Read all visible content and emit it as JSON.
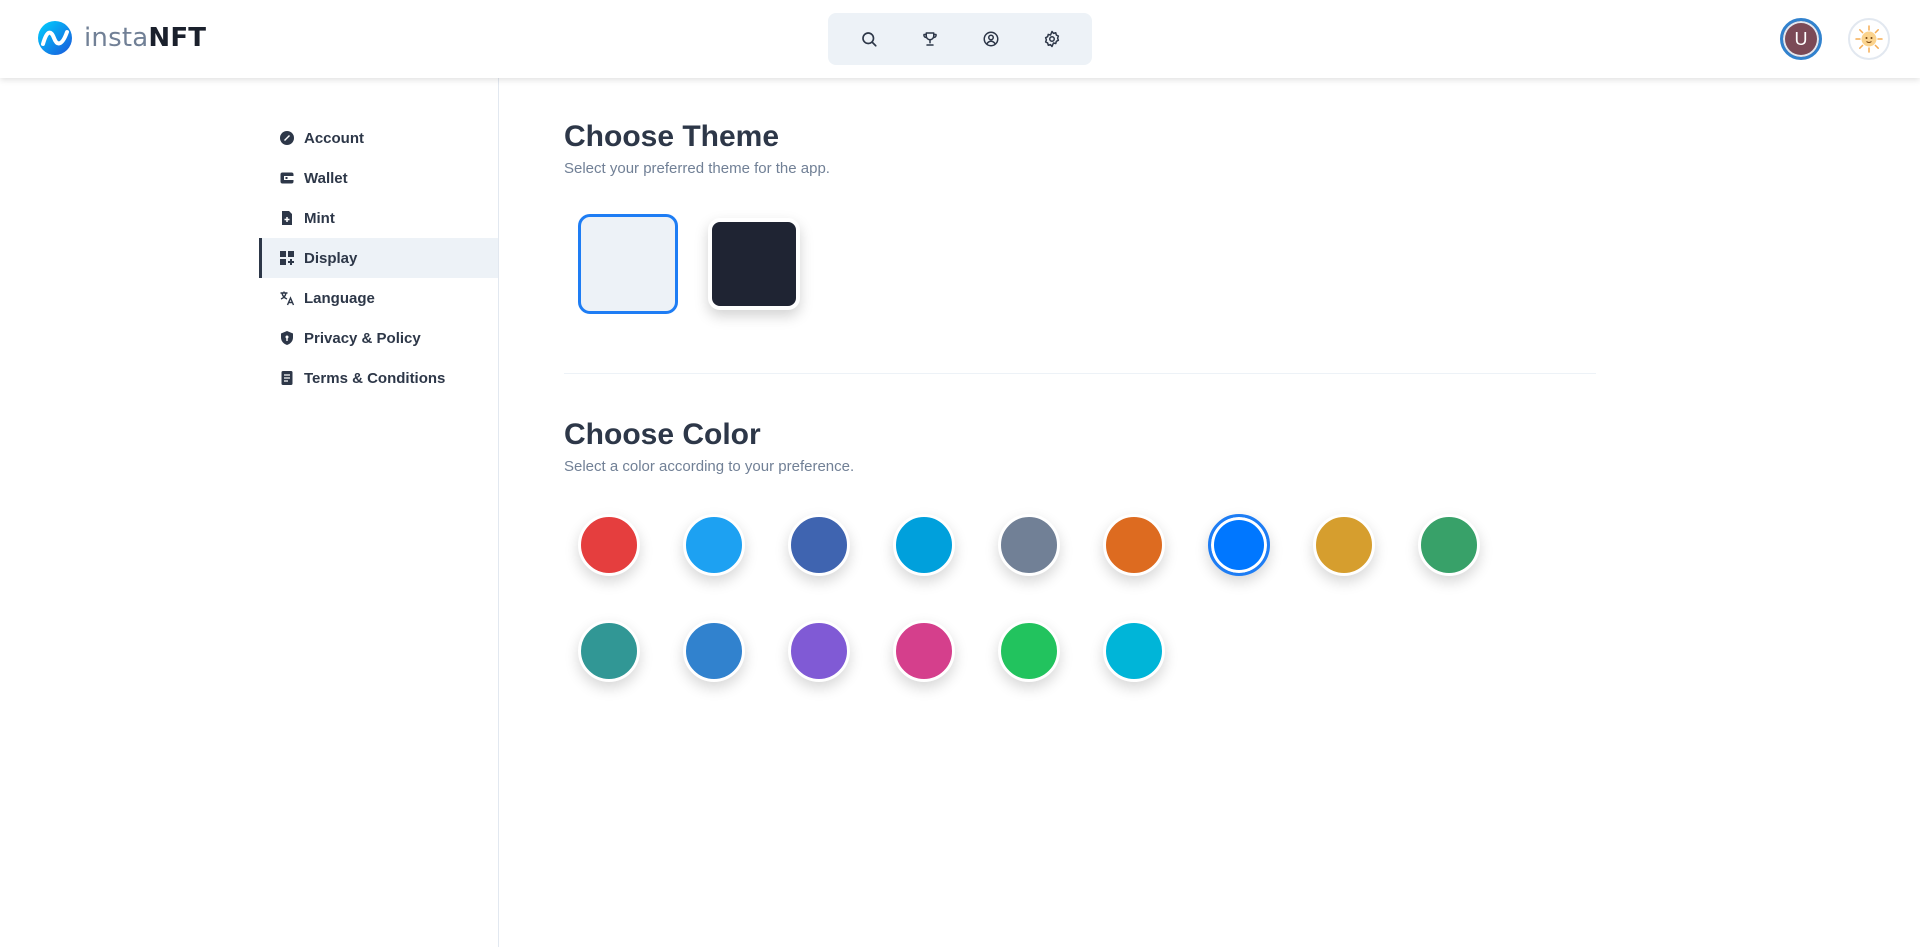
{
  "brand": {
    "name_part1": "insta",
    "name_part2": "NFT"
  },
  "topnav": {
    "icons": [
      "search-icon",
      "trophy-icon",
      "user-circle-icon",
      "gear-icon"
    ]
  },
  "user": {
    "avatar_initial": "U",
    "avatar_color": "#7b4a57"
  },
  "sidebar": {
    "items": [
      {
        "label": "Account",
        "icon": "account-icon"
      },
      {
        "label": "Wallet",
        "icon": "wallet-icon"
      },
      {
        "label": "Mint",
        "icon": "document-plus-icon"
      },
      {
        "label": "Display",
        "icon": "grid-icon",
        "active": true
      },
      {
        "label": "Language",
        "icon": "translate-icon"
      },
      {
        "label": "Privacy & Policy",
        "icon": "shield-icon"
      },
      {
        "label": "Terms & Conditions",
        "icon": "document-icon"
      }
    ]
  },
  "theme": {
    "title": "Choose Theme",
    "subtitle": "Select your preferred theme for the app.",
    "options": [
      {
        "name": "light",
        "color": "#edf2f7",
        "selected": true
      },
      {
        "name": "dark",
        "color": "#1f2433",
        "selected": false
      }
    ]
  },
  "color": {
    "title": "Choose Color",
    "subtitle": "Select a color according to your preference.",
    "options": [
      {
        "color": "#e53e3e"
      },
      {
        "color": "#1da1f2"
      },
      {
        "color": "#3f64b0"
      },
      {
        "color": "#00a0dc"
      },
      {
        "color": "#718096"
      },
      {
        "color": "#dd6b20"
      },
      {
        "color": "#0077ff",
        "selected": true
      },
      {
        "color": "#d69e2e"
      },
      {
        "color": "#38a169"
      },
      {
        "color": "#319795"
      },
      {
        "color": "#3182ce"
      },
      {
        "color": "#805ad5"
      },
      {
        "color": "#d53f8c"
      },
      {
        "color": "#22c35e"
      },
      {
        "color": "#00b5d8"
      }
    ]
  }
}
